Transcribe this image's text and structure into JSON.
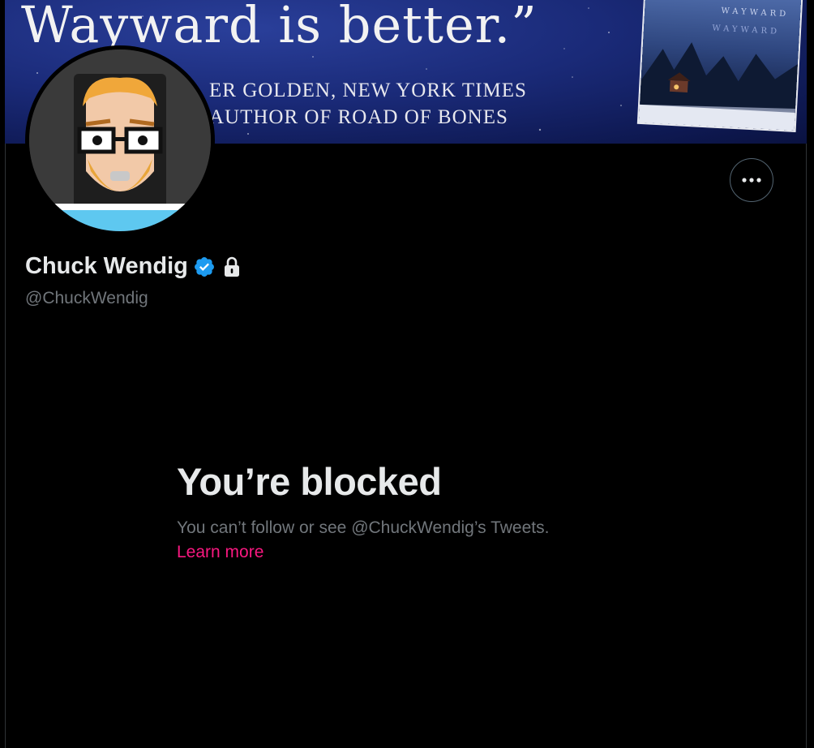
{
  "banner": {
    "quote_line": "Wayward is better.”",
    "attribution_line1": "ER GOLDEN, NEW YORK TIMES",
    "attribution_line2": "AUTHOR OF ROAD OF BONES",
    "book_cover_text": "WAYWARD",
    "book_cover_text2": "WAYWARD"
  },
  "profile": {
    "display_name": "Chuck Wendig",
    "handle": "@ChuckWendig",
    "verified": true,
    "protected": true
  },
  "actions": {
    "more_label": "More"
  },
  "blocked": {
    "title": "You’re blocked",
    "description": "You can’t follow or see @ChuckWendig’s Tweets.",
    "learn_more": "Learn more"
  },
  "colors": {
    "background": "#000000",
    "text_primary": "#e7e9ea",
    "text_secondary": "#71767b",
    "accent_link": "#f91880",
    "verified_blue": "#1d9bf0"
  },
  "icons": {
    "verified": "verified-badge-icon",
    "lock": "lock-icon",
    "more": "more-dots-icon"
  }
}
